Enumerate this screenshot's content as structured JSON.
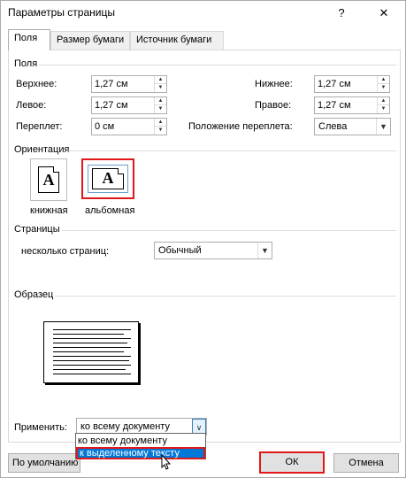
{
  "window": {
    "title": "Параметры страницы",
    "help": "?",
    "close": "✕"
  },
  "tabs": [
    {
      "label": "Поля",
      "active": true
    },
    {
      "label": "Размер бумаги",
      "active": false
    },
    {
      "label": "Источник бумаги",
      "active": false
    }
  ],
  "margins": {
    "heading": "Поля",
    "top_label": "Верхнее:",
    "top_value": "1,27 см",
    "bottom_label": "Нижнее:",
    "bottom_value": "1,27 см",
    "left_label": "Левое:",
    "left_value": "1,27 см",
    "right_label": "Правое:",
    "right_value": "1,27 см",
    "gutter_label": "Переплет:",
    "gutter_value": "0 см",
    "gutter_pos_label": "Положение переплета:",
    "gutter_pos_value": "Слева"
  },
  "orientation": {
    "heading": "Ориентация",
    "portrait_label": "книжная",
    "landscape_label": "альбомная",
    "icon_letter": "A",
    "selected": "landscape"
  },
  "pages": {
    "heading": "Страницы",
    "multiple_label": "несколько страниц:",
    "multiple_value": "Обычный"
  },
  "preview": {
    "heading": "Образец"
  },
  "apply": {
    "label": "Применить:",
    "value": "ко всему документу",
    "options": [
      "ко всему документу",
      "к выделенному тексту"
    ],
    "highlighted_index": 1
  },
  "buttons": {
    "default": "По умолчанию",
    "ok": "ОК",
    "cancel": "Отмена"
  },
  "colors": {
    "highlight_border": "#e01818",
    "selection": "#0078d7"
  }
}
